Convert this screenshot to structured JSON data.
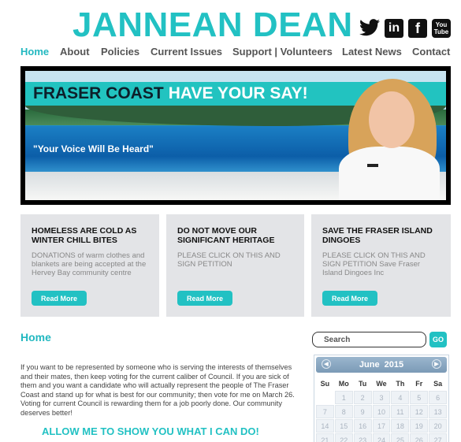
{
  "header": {
    "site_title": "JANNEAN DEAN",
    "social": [
      {
        "name": "twitter-icon"
      },
      {
        "name": "linkedin-icon",
        "glyph": "in"
      },
      {
        "name": "facebook-icon",
        "glyph": "f"
      },
      {
        "name": "youtube-icon",
        "glyph_top": "You",
        "glyph_bottom": "Tube"
      }
    ]
  },
  "nav": {
    "items": [
      "Home",
      "About",
      "Policies",
      "Current Issues",
      "Support | Volunteers",
      "Latest News",
      "Contact"
    ],
    "active": "Home"
  },
  "banner": {
    "headline_dark": "FRASER COAST",
    "headline_light": "HAVE YOUR SAY!",
    "quote": "\"Your Voice Will Be Heard\""
  },
  "cards": [
    {
      "title": "HOMELESS ARE COLD AS WINTER CHILL BITES",
      "body": "DONATIONS of warm clothes and blankets are being accepted at the Hervey Bay community centre",
      "button": "Read More"
    },
    {
      "title": "DO NOT MOVE OUR SIGNIFICANT HERITAGE",
      "body": "PLEASE CLICK ON THIS AND SIGN PETITION",
      "button": "Read More"
    },
    {
      "title": "SAVE THE FRASER ISLAND DINGOES",
      "body": "PLEASE CLICK ON THIS AND SIGN PETITION    Save Fraser Island Dingoes Inc",
      "button": "Read More"
    }
  ],
  "main": {
    "heading": "Home",
    "intro": "If you want to be represented by someone who is serving the interests of themselves and their mates, then keep voting for the current caliber of Council.  If you are sick of them and you want a candidate who will actually represent the people of The Fraser Coast and stand up for what is best for our community; then vote for me on March 26.  Voting for current Council is rewarding them for a job poorly done.  Our community deserves better!",
    "cta": "ALLOW ME TO SHOW YOU WHAT I CAN DO!"
  },
  "sidebar": {
    "search_placeholder": "Search",
    "go_label": "GO",
    "calendar": {
      "month": "June",
      "year": "2015",
      "weekdays": [
        "Su",
        "Mo",
        "Tu",
        "We",
        "Th",
        "Fr",
        "Sa"
      ],
      "days": [
        "",
        "1",
        "2",
        "3",
        "4",
        "5",
        "6",
        "7",
        "8",
        "9",
        "10",
        "11",
        "12",
        "13",
        "14",
        "15",
        "16",
        "17",
        "18",
        "19",
        "20",
        "21",
        "22",
        "23",
        "24",
        "25",
        "26",
        "27"
      ]
    }
  },
  "colors": {
    "accent": "#22c1c3",
    "card_bg": "#e3e4e7",
    "text": "#444444"
  }
}
